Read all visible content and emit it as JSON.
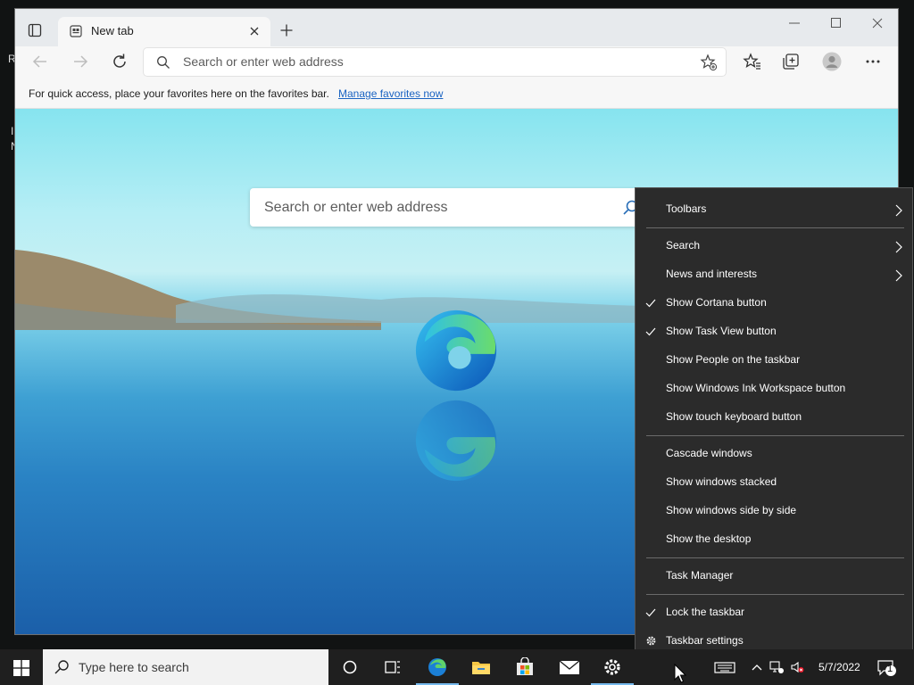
{
  "desktop": {
    "fragments": [
      "R",
      "I",
      "N"
    ]
  },
  "browser": {
    "tab": {
      "title": "New tab"
    },
    "address_bar": {
      "placeholder": "Search or enter web address"
    },
    "favorites_bar": {
      "text": "For quick access, place your favorites here on the favorites bar.",
      "link": "Manage favorites now"
    },
    "ntp_search": {
      "placeholder": "Search or enter web address"
    }
  },
  "context_menu": {
    "items": [
      {
        "label": "Toolbars",
        "checked": false,
        "submenu": true
      },
      {
        "label": "Search",
        "checked": false,
        "submenu": true
      },
      {
        "label": "News and interests",
        "checked": false,
        "submenu": true
      },
      {
        "label": "Show Cortana button",
        "checked": true,
        "submenu": false
      },
      {
        "label": "Show Task View button",
        "checked": true,
        "submenu": false
      },
      {
        "label": "Show People on the taskbar",
        "checked": false,
        "submenu": false
      },
      {
        "label": "Show Windows Ink Workspace button",
        "checked": false,
        "submenu": false
      },
      {
        "label": "Show touch keyboard button",
        "checked": false,
        "submenu": false
      },
      {
        "label": "Cascade windows",
        "checked": false,
        "submenu": false
      },
      {
        "label": "Show windows stacked",
        "checked": false,
        "submenu": false
      },
      {
        "label": "Show windows side by side",
        "checked": false,
        "submenu": false
      },
      {
        "label": "Show the desktop",
        "checked": false,
        "submenu": false
      },
      {
        "label": "Task Manager",
        "checked": false,
        "submenu": false
      },
      {
        "label": "Lock the taskbar",
        "checked": true,
        "submenu": false
      },
      {
        "label": "Taskbar settings",
        "checked": false,
        "submenu": false,
        "icon": "gear-icon"
      }
    ]
  },
  "taskbar": {
    "search_placeholder": "Type here to search",
    "apps": [
      "cortana-icon",
      "task-view-icon",
      "edge-icon",
      "file-explorer-icon",
      "store-icon",
      "mail-icon",
      "settings-icon"
    ],
    "clock": "5/7/2022",
    "notification_count": "1"
  },
  "colors": {
    "menu_bg": "#2b2b2b",
    "taskbar_bg": "#1f1f1f",
    "link": "#1a63c2",
    "accent": "#76b9ed"
  }
}
